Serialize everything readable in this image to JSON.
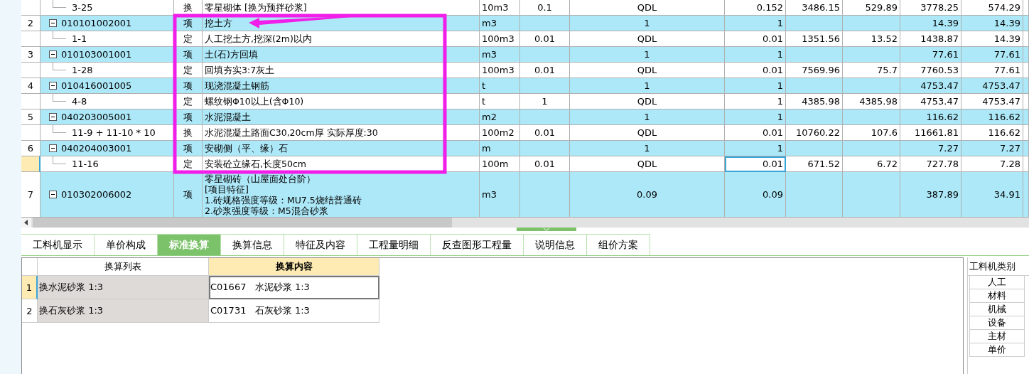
{
  "rows": [
    {
      "kind": "sub",
      "code": "3-25",
      "type": "换",
      "name": "零星砌体  [换为预拌砂浆]",
      "unit": "10m3",
      "factor": "0.1",
      "expr": "QDL",
      "qty": "0.152",
      "price": "3486.15",
      "col_11": "529.89",
      "total": "3778.25",
      "col_13": "574.29",
      "selected": false
    },
    {
      "kind": "item",
      "number": "2",
      "code": "010101002001",
      "type": "项",
      "name": "挖土方",
      "unit": "m3",
      "expr": "1",
      "qty": "1",
      "total": "14.39",
      "col_13": "14.39",
      "expanded": true,
      "selected": false,
      "children": [
        {
          "kind": "sub",
          "code": "1-1",
          "type": "定",
          "name": "人工挖土方,挖深(2m)以内",
          "unit": "100m3",
          "factor": "0.01",
          "expr": "QDL",
          "qty": "0.01",
          "price": "1351.56",
          "col_11": "13.52",
          "total": "1438.87",
          "col_13": "14.39",
          "selected": false
        }
      ]
    },
    {
      "kind": "item",
      "number": "3",
      "code": "010103001001",
      "type": "项",
      "name": "土(石)方回填",
      "unit": "m3",
      "expr": "1",
      "qty": "1",
      "total": "77.61",
      "col_13": "77.61",
      "expanded": true,
      "selected": false,
      "children": [
        {
          "kind": "sub",
          "code": "1-28",
          "type": "定",
          "name": "回填夯实3:7灰土",
          "unit": "100m3",
          "factor": "0.01",
          "expr": "QDL",
          "qty": "0.01",
          "price": "7569.96",
          "col_11": "75.7",
          "total": "7760.53",
          "col_13": "77.61",
          "selected": false
        }
      ]
    },
    {
      "kind": "item",
      "number": "4",
      "code": "010416001005",
      "type": "项",
      "name": "现浇混凝土钢筋",
      "unit": "t",
      "expr": "1",
      "qty": "1",
      "total": "4753.47",
      "col_13": "4753.47",
      "expanded": true,
      "selected": false,
      "children": [
        {
          "kind": "sub",
          "code": "4-8",
          "type": "定",
          "name": "螺纹钢Φ10以上(含Φ10)",
          "unit": "t",
          "factor": "1",
          "expr": "QDL",
          "qty": "1",
          "price": "4385.98",
          "col_11": "4385.98",
          "total": "4753.47",
          "col_13": "4753.47",
          "selected": false
        }
      ]
    },
    {
      "kind": "item",
      "number": "5",
      "code": "040203005001",
      "type": "项",
      "name": "水泥混凝土",
      "unit": "m2",
      "expr": "1",
      "qty": "1",
      "total": "116.62",
      "col_13": "116.62",
      "expanded": true,
      "selected": false,
      "children": [
        {
          "kind": "sub",
          "code": "11-9 + 11-10 * 10",
          "type": "换",
          "name": "水泥混凝土路面C30,20cm厚  实际厚度:30",
          "unit": "100m2",
          "factor": "0.01",
          "expr": "QDL",
          "qty": "0.01",
          "price": "10760.22",
          "col_11": "107.6",
          "total": "11661.81",
          "col_13": "116.62",
          "selected": false
        }
      ]
    },
    {
      "kind": "item",
      "number": "6",
      "code": "040204003001",
      "type": "项",
      "name": "安砌侧（平、缘）石",
      "unit": "m",
      "expr": "1",
      "qty": "1",
      "total": "7.27",
      "col_13": "7.27",
      "expanded": true,
      "selected": false,
      "children": [
        {
          "kind": "sub",
          "code": "11-16",
          "type": "定",
          "name": "安装砼立缘石,长度50cm",
          "unit": "100m",
          "factor": "0.01",
          "expr": "QDL",
          "qty": "0.01",
          "price": "671.52",
          "col_11": "6.72",
          "total": "727.78",
          "col_13": "7.28",
          "selected": true
        }
      ]
    },
    {
      "kind": "item",
      "number": "7",
      "code": "010302006002",
      "type": "项",
      "name": "零星砌砖（山屋面处台阶）\n[项目特征]\n1.砖规格强度等级：MU7.5烧结普通砖\n2.砂浆强度等级：M5混合砂浆",
      "unit": "m3",
      "expr": "0.09",
      "qty": "0.09",
      "total": "387.89",
      "col_13": "34.91",
      "expanded": true,
      "selected": false
    }
  ],
  "tabs": [
    {
      "label": "工料机显示",
      "selected": false
    },
    {
      "label": "单价构成",
      "selected": false
    },
    {
      "label": "标准换算",
      "selected": true
    },
    {
      "label": "换算信息",
      "selected": false
    },
    {
      "label": "特征及内容",
      "selected": false
    },
    {
      "label": "工程量明细",
      "selected": false
    },
    {
      "label": "反查图形工程量",
      "selected": false
    },
    {
      "label": "说明信息",
      "selected": false
    },
    {
      "label": "组价方案",
      "selected": false
    }
  ],
  "conversion_table": {
    "columns": [
      "换算列表",
      "换算内容"
    ],
    "rows": [
      {
        "number": "1",
        "list": "换水泥砂浆 1:3",
        "content": "C01667   水泥砂浆 1:3",
        "selected": true
      },
      {
        "number": "2",
        "list": "换石灰砂浆 1:3",
        "content": "C01731   石灰砂浆 1:3",
        "selected": false
      }
    ]
  },
  "category_panel": {
    "title": "工料机类别",
    "items": [
      "人工",
      "材料",
      "机械",
      "设备",
      "主材",
      "单价"
    ]
  }
}
